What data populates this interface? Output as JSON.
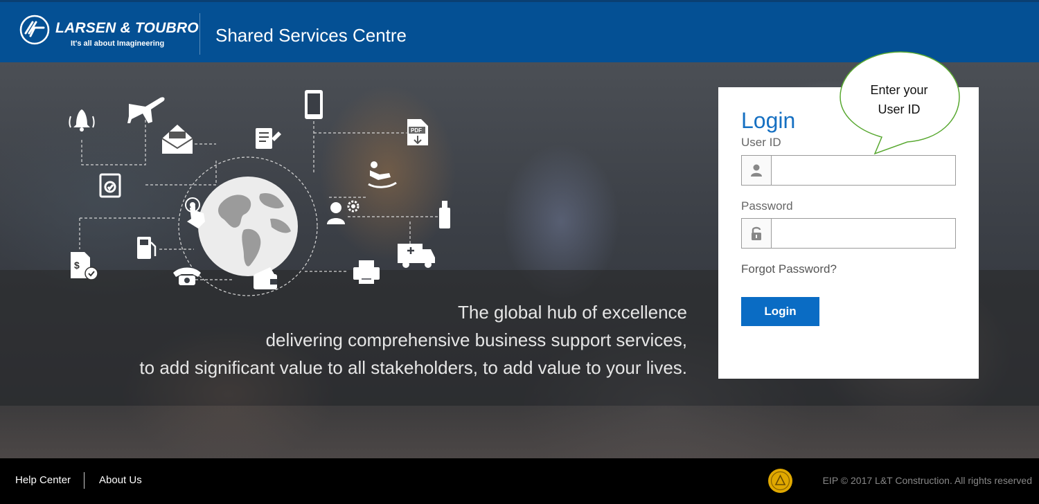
{
  "header": {
    "brand_name": "LARSEN & TOUBRO",
    "brand_tagline": "It's all about Imagineering",
    "title": "Shared Services Centre"
  },
  "hero": {
    "tagline_1": "The global hub of excellence",
    "tagline_2": "delivering comprehensive business support services,",
    "tagline_3": "to add significant value to all stakeholders, to add value to your lives.",
    "icons": [
      "bell-icon",
      "airplane-icon",
      "mail-icon",
      "clipboard-icon",
      "document-edit-icon",
      "smartphone-icon",
      "pdf-icon",
      "recliner-icon",
      "touch-icon",
      "user-settings-icon",
      "usb-drive-icon",
      "ambulance-icon",
      "invoice-dollar-icon",
      "fuel-pump-icon",
      "telephone-icon",
      "wallet-icon",
      "printer-icon",
      "globe-icon"
    ]
  },
  "login": {
    "title": "Login",
    "user_label": "User ID",
    "user_value": "",
    "password_label": "Password",
    "password_value": "",
    "forgot_label": "Forgot Password?",
    "button_label": "Login"
  },
  "callout": {
    "line_1": "Enter your",
    "line_2": "User ID"
  },
  "footer": {
    "links": [
      "Help Center",
      "About Us"
    ],
    "copyright": "EIP © 2017 L&T Construction. All rights reserved"
  },
  "colors": {
    "header_bg": "#045094",
    "accent_blue": "#0a6cc4",
    "callout_border": "#58a830",
    "footer_bg": "#000000",
    "seal_gold": "#e0a800"
  }
}
